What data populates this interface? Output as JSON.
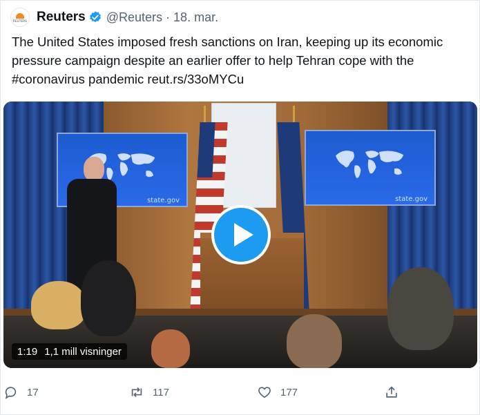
{
  "author": {
    "avatar_text": "REUTERS",
    "name": "Reuters",
    "handle_date": "@Reuters · 18. mar."
  },
  "tweet": {
    "text": "The United States imposed fresh sanctions on Iran, keeping up its economic pressure campaign despite an earlier offer to help Tehran cope with the #coronavirus pandemic reut.rs/33oMYCu"
  },
  "video": {
    "screen_url_left": "state.gov",
    "screen_url_right": "state.gov",
    "duration": "1:19",
    "views": "1,1 mill visninger"
  },
  "actions": {
    "replies": "17",
    "retweets": "117",
    "likes": "177"
  },
  "colors": {
    "accent": "#1d9bf0",
    "muted": "#536471",
    "text": "#0f1419"
  },
  "icons": [
    "verified-badge-icon",
    "reply-icon",
    "retweet-icon",
    "like-icon",
    "share-icon",
    "play-icon"
  ]
}
